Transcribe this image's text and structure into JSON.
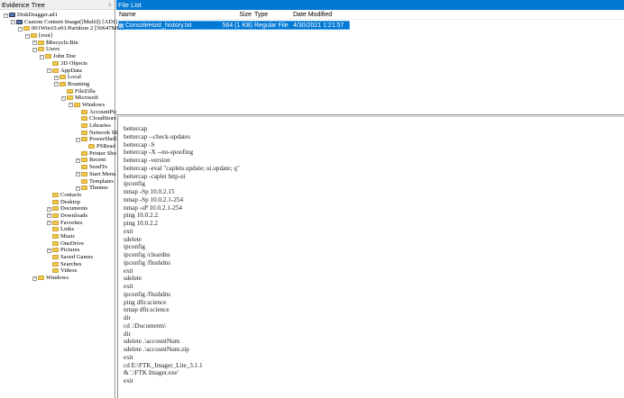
{
  "evidence_tree": {
    "title": "Evidence Tree",
    "close": "×",
    "items": [
      {
        "label": "DiskDragger.ad1",
        "depth": 0,
        "expander": "-",
        "icon": "evidence-icon"
      },
      {
        "label": "Custom Content Image([Multi]) [AD1]",
        "depth": 1,
        "expander": "-",
        "icon": "image-icon"
      },
      {
        "label": "001Win10.e01:Partition 2 [50647MB]",
        "depth": 2,
        "expander": "-",
        "icon": "folder-icon"
      },
      {
        "label": "[root]",
        "depth": 3,
        "expander": "-",
        "icon": "folder-icon"
      },
      {
        "label": "$Recycle.Bin",
        "depth": 4,
        "expander": "+",
        "icon": "folder-icon"
      },
      {
        "label": "Users",
        "depth": 4,
        "expander": "-",
        "icon": "folder-icon"
      },
      {
        "label": "John Doe",
        "depth": 5,
        "expander": "-",
        "icon": "folder-icon"
      },
      {
        "label": "3D Objects",
        "depth": 6,
        "expander": "",
        "icon": "folder-icon"
      },
      {
        "label": "AppData",
        "depth": 6,
        "expander": "-",
        "icon": "folder-icon"
      },
      {
        "label": "Local",
        "depth": 7,
        "expander": "+",
        "icon": "folder-icon"
      },
      {
        "label": "Roaming",
        "depth": 7,
        "expander": "-",
        "icon": "folder-icon"
      },
      {
        "label": "FileZilla",
        "depth": 8,
        "expander": "",
        "icon": "folder-icon"
      },
      {
        "label": "Microsoft",
        "depth": 8,
        "expander": "-",
        "icon": "folder-icon"
      },
      {
        "label": "Windows",
        "depth": 9,
        "expander": "-",
        "icon": "folder-icon"
      },
      {
        "label": "AccountPic",
        "depth": 10,
        "expander": "",
        "icon": "folder-icon"
      },
      {
        "label": "CloudStore",
        "depth": 10,
        "expander": "",
        "icon": "folder-icon"
      },
      {
        "label": "Libraries",
        "depth": 10,
        "expander": "",
        "icon": "folder-icon"
      },
      {
        "label": "Network Sh",
        "depth": 10,
        "expander": "",
        "icon": "folder-icon"
      },
      {
        "label": "PowerShell",
        "depth": 10,
        "expander": "-",
        "icon": "folder-icon"
      },
      {
        "label": "PSRead",
        "depth": 11,
        "expander": "",
        "icon": "folder-icon"
      },
      {
        "label": "Printer Sho",
        "depth": 10,
        "expander": "",
        "icon": "folder-icon"
      },
      {
        "label": "Recent",
        "depth": 10,
        "expander": "+",
        "icon": "folder-icon"
      },
      {
        "label": "SendTo",
        "depth": 10,
        "expander": "",
        "icon": "folder-icon"
      },
      {
        "label": "Start Menu",
        "depth": 10,
        "expander": "+",
        "icon": "folder-icon"
      },
      {
        "label": "Templates",
        "depth": 10,
        "expander": "",
        "icon": "folder-icon"
      },
      {
        "label": "Themes",
        "depth": 10,
        "expander": "+",
        "icon": "folder-icon"
      },
      {
        "label": "Contacts",
        "depth": 6,
        "expander": "",
        "icon": "folder-icon"
      },
      {
        "label": "Desktop",
        "depth": 6,
        "expander": "",
        "icon": "folder-icon"
      },
      {
        "label": "Documents",
        "depth": 6,
        "expander": "+",
        "icon": "folder-icon"
      },
      {
        "label": "Downloads",
        "depth": 6,
        "expander": "+",
        "icon": "folder-icon"
      },
      {
        "label": "Favorites",
        "depth": 6,
        "expander": "+",
        "icon": "folder-icon"
      },
      {
        "label": "Links",
        "depth": 6,
        "expander": "",
        "icon": "folder-icon"
      },
      {
        "label": "Music",
        "depth": 6,
        "expander": "",
        "icon": "folder-icon"
      },
      {
        "label": "OneDrive",
        "depth": 6,
        "expander": "",
        "icon": "folder-icon"
      },
      {
        "label": "Pictures",
        "depth": 6,
        "expander": "+",
        "icon": "folder-icon"
      },
      {
        "label": "Saved Games",
        "depth": 6,
        "expander": "",
        "icon": "folder-icon"
      },
      {
        "label": "Searches",
        "depth": 6,
        "expander": "",
        "icon": "folder-icon"
      },
      {
        "label": "Videos",
        "depth": 6,
        "expander": "",
        "icon": "folder-icon"
      },
      {
        "label": "Windows",
        "depth": 4,
        "expander": "+",
        "icon": "folder-icon"
      }
    ]
  },
  "file_list": {
    "title": "File List",
    "columns": {
      "name": "Name",
      "size": "Size",
      "type": "Type",
      "date": "Date Modified"
    },
    "rows": [
      {
        "name": "ConsoleHost_history.txt",
        "size": "564 (1 KB)",
        "type": "Regular File",
        "date": "4/30/2021 1:21:57 AM",
        "selected": true
      }
    ]
  },
  "viewer": {
    "lines": [
      "bettercap",
      "bettercap --check-updates",
      "bettercap -S",
      "bettercap -X --no-spoofing",
      "bettercap -version",
      "bettercap -eval \"caplets.update; ui.update; q\"",
      "bettercap -caplet http-ui",
      "ipconfig",
      "nmap -Sp 10.0.2.15",
      "nmap -Sp 10.0.2.1-254",
      "nmap -sP 10.0.2.1-254",
      "ping 10.0.2.2.",
      "ping 10.0.2.2",
      "exit",
      "sdelete",
      "ipconfig",
      "ipconfig /cleardns",
      "ipconfig /flushdns",
      "exit",
      "sdelete",
      "exit",
      "ipconfig /flushdns",
      "ping dfir.science",
      "nmap dfir.science",
      "dir",
      "cd .\\Documents\\",
      "dir",
      "sdelete .\\accountNum",
      "sdelete .\\accountNum.zip",
      "exit",
      "cd E:\\FTK_Imager_Lite_3.1.1",
      "& '.\\FTK Imager.exe'",
      "exit"
    ]
  },
  "colors": {
    "accent": "#0078d4"
  }
}
